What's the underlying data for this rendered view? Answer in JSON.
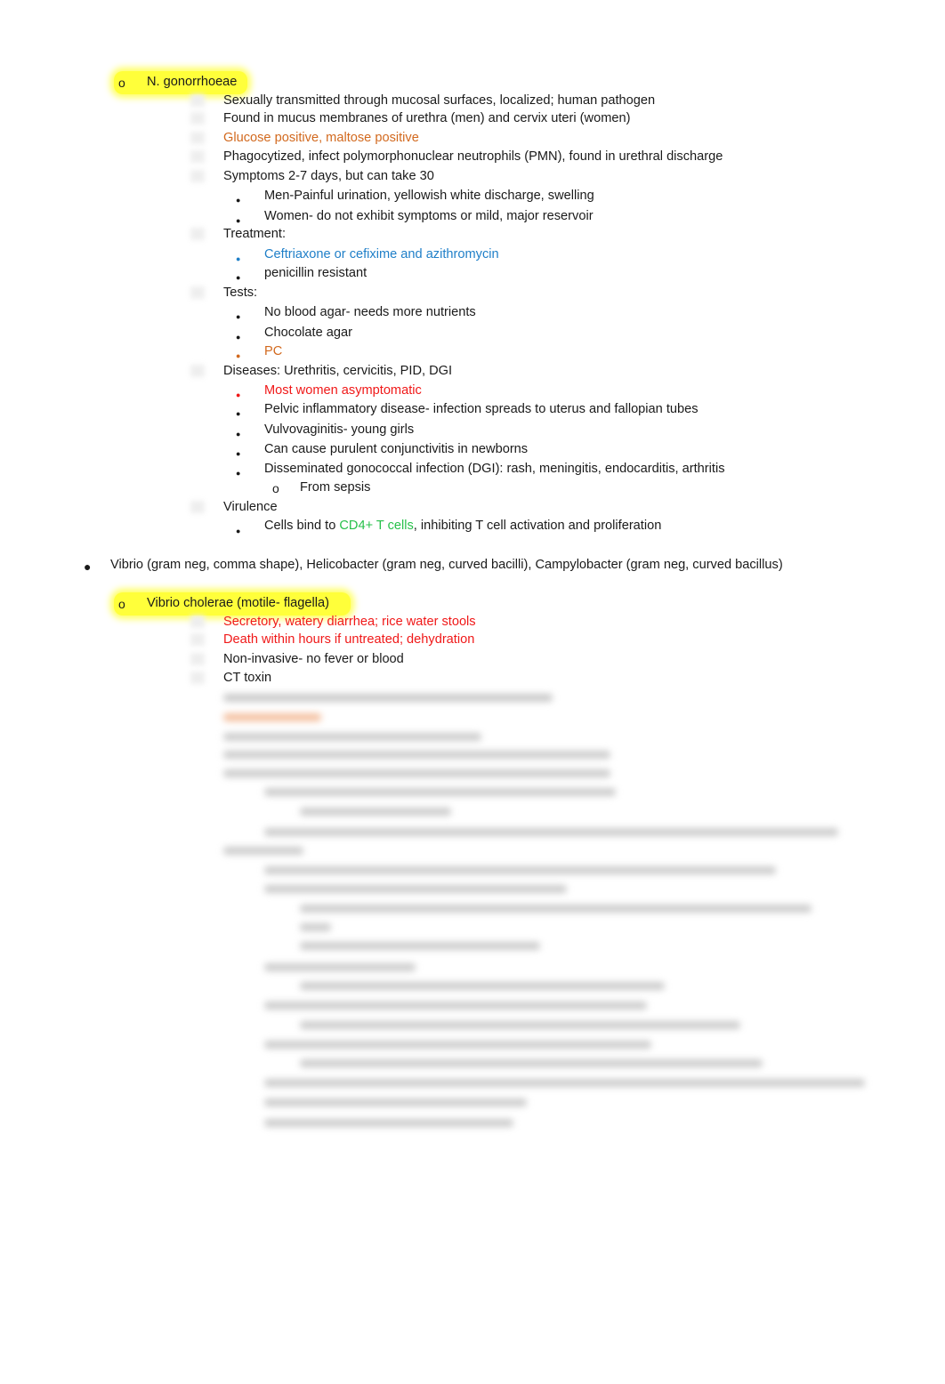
{
  "ngon": {
    "heading": "N. gonorrhoeae",
    "lines": [
      "Sexually transmitted through mucosal surfaces, localized; human pathogen",
      "Found in mucus membranes of urethra (men) and cervix uteri (women)",
      "Glucose positive, maltose positive",
      "Phagocytized, infect polymorphonuclear neutrophils (PMN), found in urethral discharge",
      "Symptoms 2-7 days, but can take 30"
    ],
    "symptoms": [
      "Men-Painful urination, yellowish white discharge, swelling",
      "Women- do not exhibit symptoms or mild, major reservoir"
    ],
    "treatment_label": "Treatment:",
    "treatment": [
      "Ceftriaxone or cefixime and azithromycin",
      "penicillin resistant"
    ],
    "tests_label": "Tests:",
    "tests": [
      "No blood agar- needs more nutrients",
      "Chocolate agar",
      "PC"
    ],
    "diseases_label": "Diseases: Urethritis, cervicitis, PID, DGI",
    "diseases": [
      "Most women asymptomatic",
      "Pelvic inflammatory disease- infection spreads to uterus and fallopian tubes",
      "Vulvovaginitis- young girls",
      "Can cause purulent conjunctivitis in newborns",
      "Disseminated gonococcal infection (DGI): rash, meningitis, endocarditis, arthritis"
    ],
    "dgi_sub": "From sepsis",
    "virulence_label": "Virulence",
    "virulence_pre": "Cells bind to ",
    "virulence_green": "CD4+ T cells",
    "virulence_post": ", inhibiting T cell activation and proliferation"
  },
  "vibrio_group": "Vibrio (gram neg, comma shape), Helicobacter (gram neg, curved bacilli), Campylobacter (gram neg, curved bacillus)",
  "vcholerae": {
    "heading": "Vibrio cholerae (motile- flagella)",
    "lines": [
      "Secretory, watery diarrhea; rice water stools",
      "Death within hours if untreated; dehydration",
      "Non-invasive- no fever or blood",
      "CT toxin"
    ]
  },
  "bullets": {
    "hollow": "o",
    "solid": "●"
  },
  "colors": {
    "highlight": "#ffff3a",
    "orange": "#d2691e",
    "blue": "#1f7fc8",
    "red": "#f01818",
    "green": "#27c04a"
  }
}
